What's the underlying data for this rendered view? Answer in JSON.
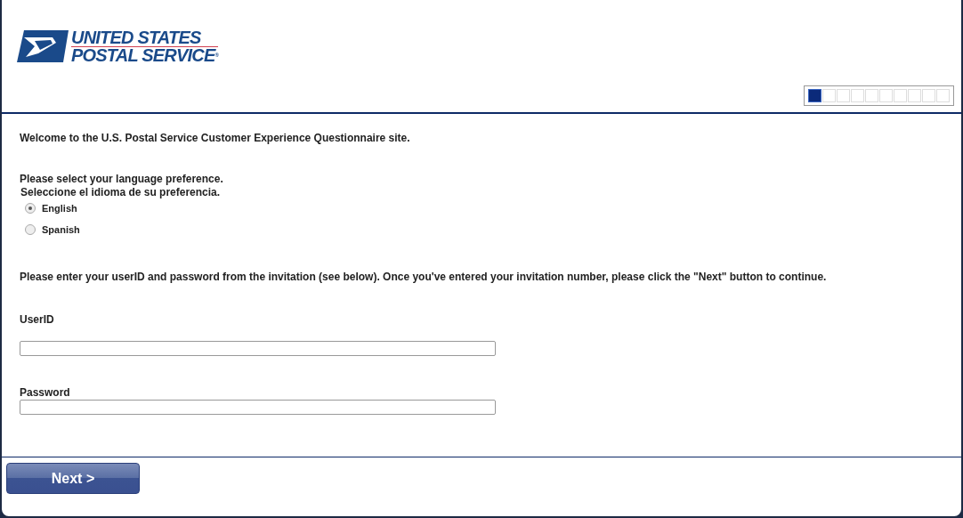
{
  "logo": {
    "line_1": "UNITED STATES",
    "line_2": "POSTAL SERVICE",
    "mark": "®"
  },
  "progress": {
    "level": 0.1
  },
  "welcome": "Welcome to the U.S. Postal Service Customer Experience Questionnaire site.",
  "language_prompt": [
    "Please select your language preference.",
    "Seleccione el idioma de su preferencia."
  ],
  "languages": [
    {
      "label": "English",
      "selected": true
    },
    {
      "label": "Spanish",
      "selected": false
    }
  ],
  "instructions": "Please enter your userID and password from the invitation (see below). Once you've entered your invitation number, please click the \"Next\" button to continue.",
  "fields": [
    {
      "label": "UserID"
    },
    {
      "label": "Password"
    }
  ],
  "next_button": "Next >"
}
